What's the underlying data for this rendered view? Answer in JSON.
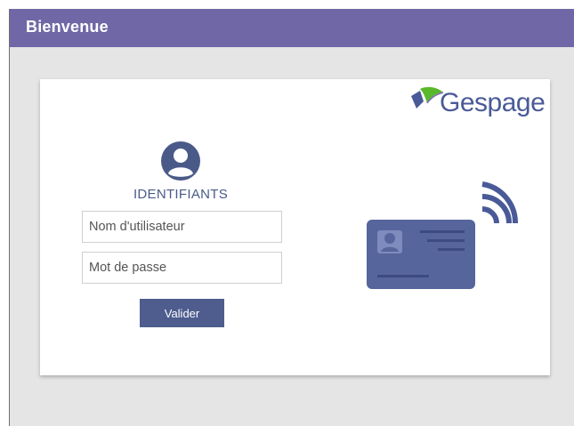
{
  "window": {
    "title": "Bienvenue"
  },
  "brand": {
    "logo_text": "Gespage"
  },
  "login": {
    "heading": "IDENTIFIANTS",
    "username_placeholder": "Nom d'utilisateur",
    "username_value": "",
    "password_placeholder": "Mot de passe",
    "password_value": "",
    "submit_label": "Valider"
  },
  "icons": {
    "user": "user-circle-icon",
    "logo_mark": "gespage-leaf-icon",
    "badge": "contactless-id-card-icon"
  },
  "colors": {
    "titlebar": "#7068a6",
    "accent": "#4e5c8e",
    "illustration": "#56659c",
    "logo_green": "#5ab82c"
  }
}
